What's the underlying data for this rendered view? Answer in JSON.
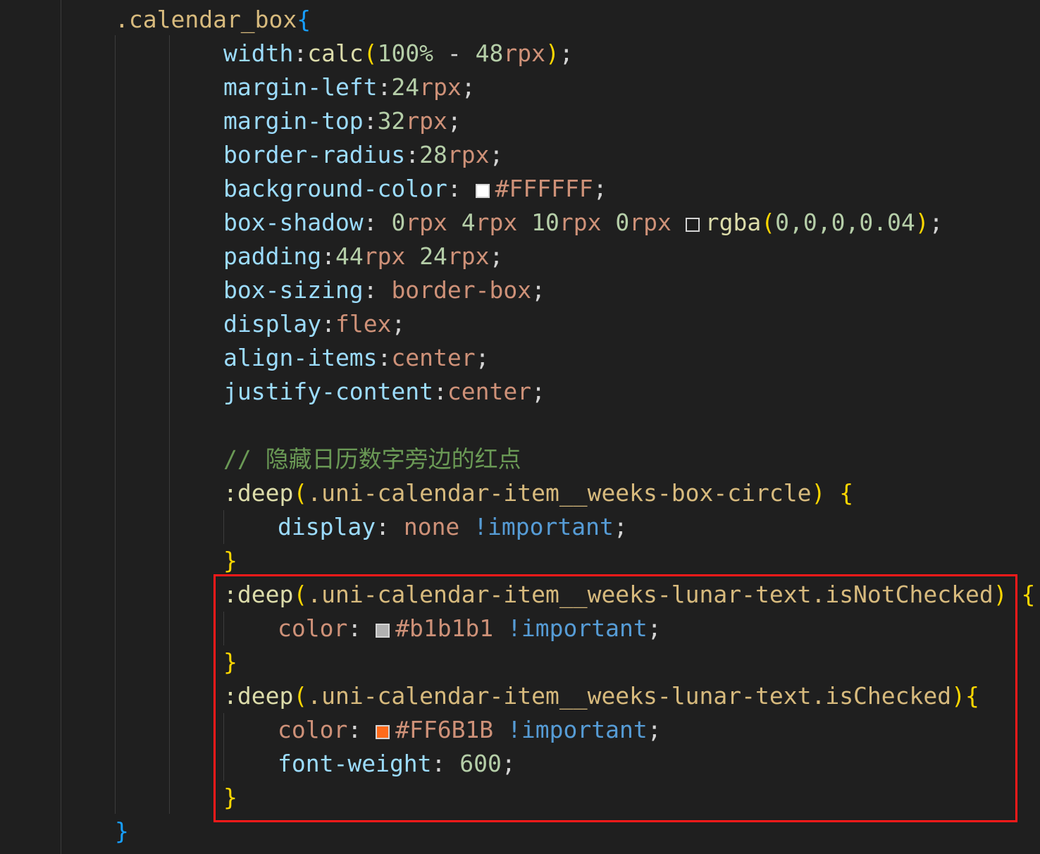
{
  "code": {
    "lines": [
      {
        "indent": 0,
        "tokens": [
          {
            "t": ".calendar_box",
            "c": "sel"
          },
          {
            "t": "{",
            "c": "brace-b"
          }
        ]
      },
      {
        "indent": 2,
        "tokens": [
          {
            "t": "width",
            "c": "prop"
          },
          {
            "t": ":",
            "c": "p"
          },
          {
            "t": "calc",
            "c": "fn"
          },
          {
            "t": "(",
            "c": "brace-y"
          },
          {
            "t": "100%",
            "c": "num"
          },
          {
            "t": " - ",
            "c": "p"
          },
          {
            "t": "48",
            "c": "num"
          },
          {
            "t": "rpx",
            "c": "kw"
          },
          {
            "t": ")",
            "c": "brace-y"
          },
          {
            "t": ";",
            "c": "p"
          }
        ]
      },
      {
        "indent": 2,
        "tokens": [
          {
            "t": "margin-left",
            "c": "prop"
          },
          {
            "t": ":",
            "c": "p"
          },
          {
            "t": "24",
            "c": "num"
          },
          {
            "t": "rpx",
            "c": "kw"
          },
          {
            "t": ";",
            "c": "p"
          }
        ]
      },
      {
        "indent": 2,
        "tokens": [
          {
            "t": "margin-top",
            "c": "prop"
          },
          {
            "t": ":",
            "c": "p"
          },
          {
            "t": "32",
            "c": "num"
          },
          {
            "t": "rpx",
            "c": "kw"
          },
          {
            "t": ";",
            "c": "p"
          }
        ]
      },
      {
        "indent": 2,
        "tokens": [
          {
            "t": "border-radius",
            "c": "prop"
          },
          {
            "t": ":",
            "c": "p"
          },
          {
            "t": "28",
            "c": "num"
          },
          {
            "t": "rpx",
            "c": "kw"
          },
          {
            "t": ";",
            "c": "p"
          }
        ]
      },
      {
        "indent": 2,
        "tokens": [
          {
            "t": "background-color",
            "c": "prop"
          },
          {
            "t": ": ",
            "c": "p"
          },
          {
            "swatch": "#FFFFFF"
          },
          {
            "t": "#FFFFFF",
            "c": "kw"
          },
          {
            "t": ";",
            "c": "p"
          }
        ]
      },
      {
        "indent": 2,
        "tokens": [
          {
            "t": "box-shadow",
            "c": "prop"
          },
          {
            "t": ": ",
            "c": "p"
          },
          {
            "t": "0",
            "c": "num"
          },
          {
            "t": "rpx ",
            "c": "kw"
          },
          {
            "t": "4",
            "c": "num"
          },
          {
            "t": "rpx ",
            "c": "kw"
          },
          {
            "t": "10",
            "c": "num"
          },
          {
            "t": "rpx ",
            "c": "kw"
          },
          {
            "t": "0",
            "c": "num"
          },
          {
            "t": "rpx ",
            "c": "kw"
          },
          {
            "swatch": "rgba(0,0,0,0.04)"
          },
          {
            "t": "rgba",
            "c": "fn"
          },
          {
            "t": "(",
            "c": "brace-y"
          },
          {
            "t": "0,0,0,0.04",
            "c": "num"
          },
          {
            "t": ")",
            "c": "brace-y"
          },
          {
            "t": ";",
            "c": "p"
          }
        ]
      },
      {
        "indent": 2,
        "tokens": [
          {
            "t": "padding",
            "c": "prop"
          },
          {
            "t": ":",
            "c": "p"
          },
          {
            "t": "44",
            "c": "num"
          },
          {
            "t": "rpx ",
            "c": "kw"
          },
          {
            "t": "24",
            "c": "num"
          },
          {
            "t": "rpx",
            "c": "kw"
          },
          {
            "t": ";",
            "c": "p"
          }
        ]
      },
      {
        "indent": 2,
        "tokens": [
          {
            "t": "box-sizing",
            "c": "prop"
          },
          {
            "t": ": ",
            "c": "p"
          },
          {
            "t": "border-box",
            "c": "kw"
          },
          {
            "t": ";",
            "c": "p"
          }
        ]
      },
      {
        "indent": 2,
        "tokens": [
          {
            "t": "display",
            "c": "prop"
          },
          {
            "t": ":",
            "c": "p"
          },
          {
            "t": "flex",
            "c": "kw"
          },
          {
            "t": ";",
            "c": "p"
          }
        ]
      },
      {
        "indent": 2,
        "tokens": [
          {
            "t": "align-items",
            "c": "prop"
          },
          {
            "t": ":",
            "c": "p"
          },
          {
            "t": "center",
            "c": "kw"
          },
          {
            "t": ";",
            "c": "p"
          }
        ]
      },
      {
        "indent": 2,
        "tokens": [
          {
            "t": "justify-content",
            "c": "prop"
          },
          {
            "t": ":",
            "c": "p"
          },
          {
            "t": "center",
            "c": "kw"
          },
          {
            "t": ";",
            "c": "p"
          }
        ]
      },
      {
        "indent": 2,
        "tokens": []
      },
      {
        "indent": 2,
        "tokens": [
          {
            "t": "// 隐藏日历数字旁边的红点",
            "c": "cmt"
          }
        ]
      },
      {
        "indent": 2,
        "tokens": [
          {
            "t": ":deep",
            "c": "fn"
          },
          {
            "t": "(",
            "c": "brace-y"
          },
          {
            "t": ".uni-calendar-item__weeks-box-circle",
            "c": "sel"
          },
          {
            "t": ")",
            "c": "brace-y"
          },
          {
            "t": " ",
            "c": "p"
          },
          {
            "t": "{",
            "c": "brace-y"
          }
        ]
      },
      {
        "indent": 3,
        "tokens": [
          {
            "t": "display",
            "c": "prop"
          },
          {
            "t": ": ",
            "c": "p"
          },
          {
            "t": "none ",
            "c": "kw"
          },
          {
            "t": "!important",
            "c": "imp"
          },
          {
            "t": ";",
            "c": "p"
          }
        ]
      },
      {
        "indent": 2,
        "tokens": [
          {
            "t": "}",
            "c": "brace-y"
          }
        ]
      },
      {
        "indent": 2,
        "tokens": [
          {
            "t": ":deep",
            "c": "fn"
          },
          {
            "t": "(",
            "c": "brace-y"
          },
          {
            "t": ".uni-calendar-item__weeks-lunar-text.isNotChecked",
            "c": "sel"
          },
          {
            "t": ")",
            "c": "brace-y"
          },
          {
            "t": " ",
            "c": "p"
          },
          {
            "t": "{",
            "c": "brace-y"
          }
        ]
      },
      {
        "indent": 3,
        "tokens": [
          {
            "t": "color",
            "c": "kw"
          },
          {
            "t": ": ",
            "c": "p"
          },
          {
            "swatch": "#b1b1b1"
          },
          {
            "t": "#b1b1b1 ",
            "c": "kw"
          },
          {
            "t": "!important",
            "c": "imp"
          },
          {
            "t": ";",
            "c": "p"
          }
        ]
      },
      {
        "indent": 2,
        "tokens": [
          {
            "t": "}",
            "c": "brace-y"
          }
        ]
      },
      {
        "indent": 2,
        "tokens": [
          {
            "t": ":deep",
            "c": "fn"
          },
          {
            "t": "(",
            "c": "brace-y"
          },
          {
            "t": ".uni-calendar-item__weeks-lunar-text.isChecked",
            "c": "sel"
          },
          {
            "t": ")",
            "c": "brace-y"
          },
          {
            "t": "{",
            "c": "brace-y"
          }
        ]
      },
      {
        "indent": 3,
        "tokens": [
          {
            "t": "color",
            "c": "kw"
          },
          {
            "t": ": ",
            "c": "p"
          },
          {
            "swatch": "#FF6B1B"
          },
          {
            "t": "#FF6B1B ",
            "c": "kw"
          },
          {
            "t": "!important",
            "c": "imp"
          },
          {
            "t": ";",
            "c": "p"
          }
        ]
      },
      {
        "indent": 3,
        "tokens": [
          {
            "t": "font-weight",
            "c": "prop"
          },
          {
            "t": ": ",
            "c": "p"
          },
          {
            "t": "600",
            "c": "num"
          },
          {
            "t": ";",
            "c": "p"
          }
        ]
      },
      {
        "indent": 2,
        "tokens": [
          {
            "t": "}",
            "c": "brace-y"
          }
        ]
      },
      {
        "indent": 0,
        "tokens": [
          {
            "t": "}",
            "c": "brace-b"
          }
        ]
      }
    ]
  },
  "colors": {
    "background": "#1f1f1f",
    "highlight_border": "#ff1a1a"
  }
}
